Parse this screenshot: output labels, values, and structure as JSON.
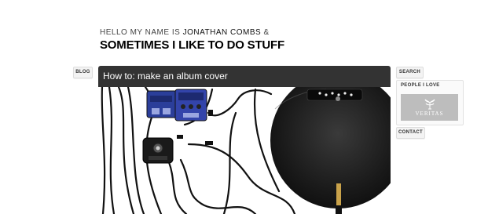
{
  "header": {
    "hello_prefix": "HELLO MY NAME IS ",
    "name": "JONATHAN COMBS",
    "hello_suffix": " &",
    "tagline": "SOMETIMES I LIKE TO DO STUFF"
  },
  "nav": {
    "blog": "BLOG",
    "search": "SEARCH",
    "contact": "CONTACT"
  },
  "sidebar": {
    "people_title": "PEOPLE I LOVE",
    "people": [
      {
        "label": "VERITAS"
      }
    ]
  },
  "post": {
    "title": "How to: make an album cover"
  },
  "colors": {
    "title_bar": "#333333",
    "veritas_bg": "#bdbdbd",
    "pedal_blue": "#2b3e9a"
  }
}
